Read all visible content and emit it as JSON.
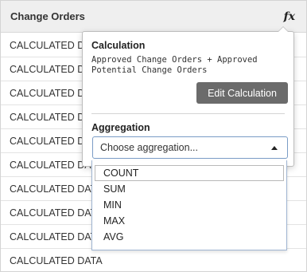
{
  "column": {
    "title": "Change Orders",
    "fx_label": "fx",
    "rows": [
      "CALCULATED DATA",
      "CALCULATED DATA",
      "CALCULATED DATA",
      "CALCULATED DATA",
      "CALCULATED DATA",
      "CALCULATED DATA",
      "CALCULATED DATA",
      "CALCULATED DATA",
      "CALCULATED DATA",
      "CALCULATED DATA"
    ]
  },
  "popover": {
    "calculation_label": "Calculation",
    "formula_line1": "Approved Change Orders + Approved",
    "formula_line2": "Potential Change Orders",
    "edit_button": "Edit Calculation",
    "aggregation_label": "Aggregation",
    "aggregation_placeholder": "Choose aggregation...",
    "options": [
      "COUNT",
      "SUM",
      "MIN",
      "MAX",
      "AVG"
    ],
    "highlighted_option": "COUNT"
  },
  "colors": {
    "header_bg": "#efefef",
    "button_bg": "#6b6b6b",
    "select_border": "#7a9cc6"
  }
}
